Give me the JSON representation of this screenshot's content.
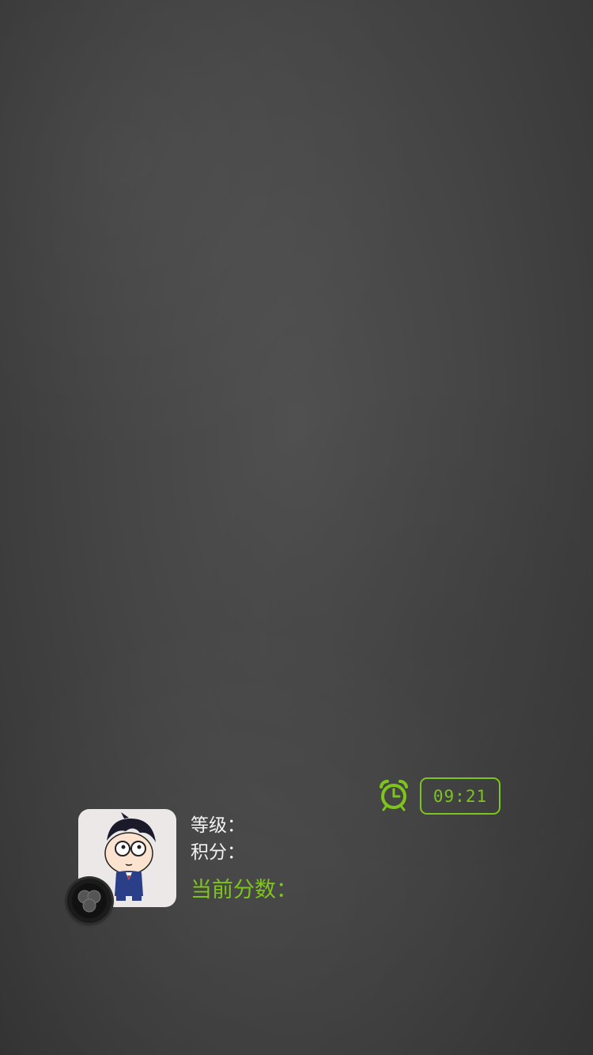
{
  "timer": {
    "value": "09:21",
    "icon": "alarm-clock-icon",
    "color": "#7dc51b"
  },
  "player": {
    "avatar_icon": "cartoon-boy-avatar",
    "badge_icon": "shutter-badge-icon",
    "level_label": "等级：",
    "points_label": "积分：",
    "current_score_label": "当前分数："
  },
  "colors": {
    "accent": "#7dc51b",
    "text": "#f2f2f2",
    "background": "#444444"
  }
}
